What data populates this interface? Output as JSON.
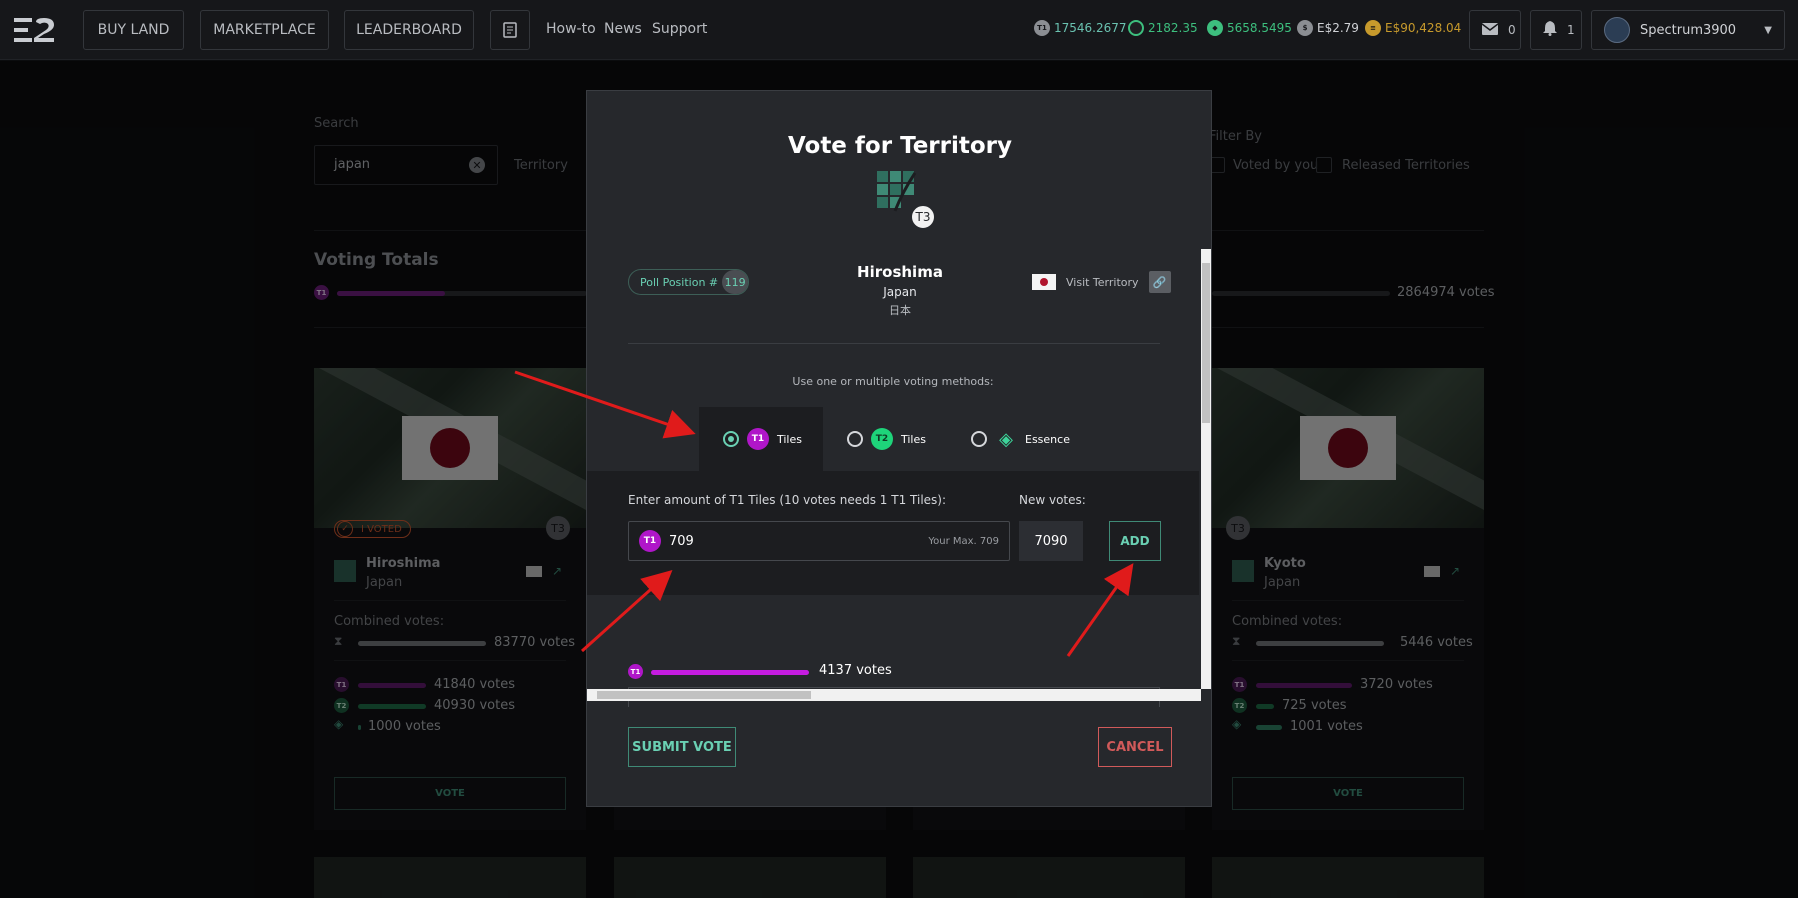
{
  "topbar": {
    "nav": [
      "BUY LAND",
      "MARKETPLACE",
      "LEADERBOARD"
    ],
    "links": [
      "How-to",
      "News",
      "Support"
    ],
    "balances": [
      {
        "icon": "t1-tile-icon",
        "value": "17546.2677",
        "color": "#6ac2b0"
      },
      {
        "icon": "t2-tile-icon",
        "value": "2182.35",
        "color": "#3dbf7e"
      },
      {
        "icon": "essence-icon",
        "value": "5658.5495",
        "color": "#3dbf7e"
      },
      {
        "icon": "dollar-icon",
        "value": "E$2.79",
        "color": "#d0d2d6"
      },
      {
        "icon": "gold-coin-icon",
        "value": "E$90,428.04",
        "color": "#c79a2c"
      }
    ],
    "mail_count": "0",
    "notif_count": "1",
    "username": "Spectrum3900"
  },
  "page": {
    "search_label": "Search",
    "search_value": "japan",
    "territory_label": "Territory",
    "filter_label": "Filter By",
    "filter_options": [
      "Voted by you",
      "Released Territories"
    ],
    "voting_totals_title": "Voting Totals",
    "total_votes": "2864974 votes",
    "cards": [
      {
        "name": "Hiroshima",
        "country": "Japan",
        "badge": "I VOTED",
        "tier": "T3",
        "combined_label": "Combined votes:",
        "combined": "83770 votes",
        "t1": "41840 votes",
        "t2": "40930 votes",
        "essence": "1000 votes",
        "vote_btn": "VOTE"
      },
      {
        "name": "Kyoto",
        "country": "Japan",
        "tier": "T3",
        "combined_label": "Combined votes:",
        "combined": "5446 votes",
        "t1": "3720 votes",
        "t2": "725 votes",
        "essence": "1001 votes",
        "vote_btn": "VOTE"
      }
    ]
  },
  "modal": {
    "title": "Vote for Territory",
    "tier": "T3",
    "poll_label": "Poll Position #",
    "poll_number": "119",
    "territory": "Hiroshima",
    "country": "Japan",
    "country_native": "日本",
    "visit_label": "Visit Territory",
    "methods_hint": "Use one or multiple voting methods:",
    "tabs": [
      {
        "token": "T1",
        "label": "Tiles",
        "selected": true
      },
      {
        "token": "T2",
        "label": "Tiles",
        "selected": false
      },
      {
        "token": "essence-icon",
        "label": "Essence",
        "selected": false
      }
    ],
    "amount_label": "Enter amount of T1 Tiles (10 votes needs 1 T1 Tiles):",
    "amount_value": "709",
    "max_label": "Your Max. 709",
    "new_votes_label": "New votes:",
    "new_votes_value": "7090",
    "add_label": "ADD",
    "t1_votes": "4137 votes",
    "submit_label": "SUBMIT VOTE",
    "cancel_label": "CANCEL"
  }
}
